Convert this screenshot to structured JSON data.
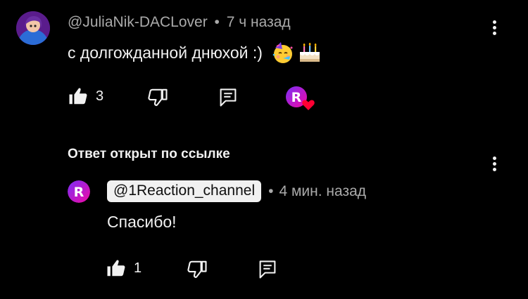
{
  "comment": {
    "author": "@JuliaNik-DACLover",
    "separator": "•",
    "time": "7 ч назад",
    "text": "с долгожданной днюхой :)",
    "emoji": [
      "partying-face",
      "birthday-cake"
    ],
    "likes": "3",
    "hearted_by": "1Reaction_channel"
  },
  "reply_section": {
    "label": "Ответ открыт по ссылке"
  },
  "reply": {
    "author": "@1Reaction_channel",
    "separator": "•",
    "time": "4 мин. назад",
    "text": "Спасибо!",
    "likes": "1"
  },
  "colors": {
    "background": "#000000",
    "text": "#f1f1f1",
    "meta": "#aaaaaa",
    "heart": "#ff0033",
    "channel_gradient_start": "#7b2ff7",
    "channel_gradient_end": "#f107a3"
  }
}
